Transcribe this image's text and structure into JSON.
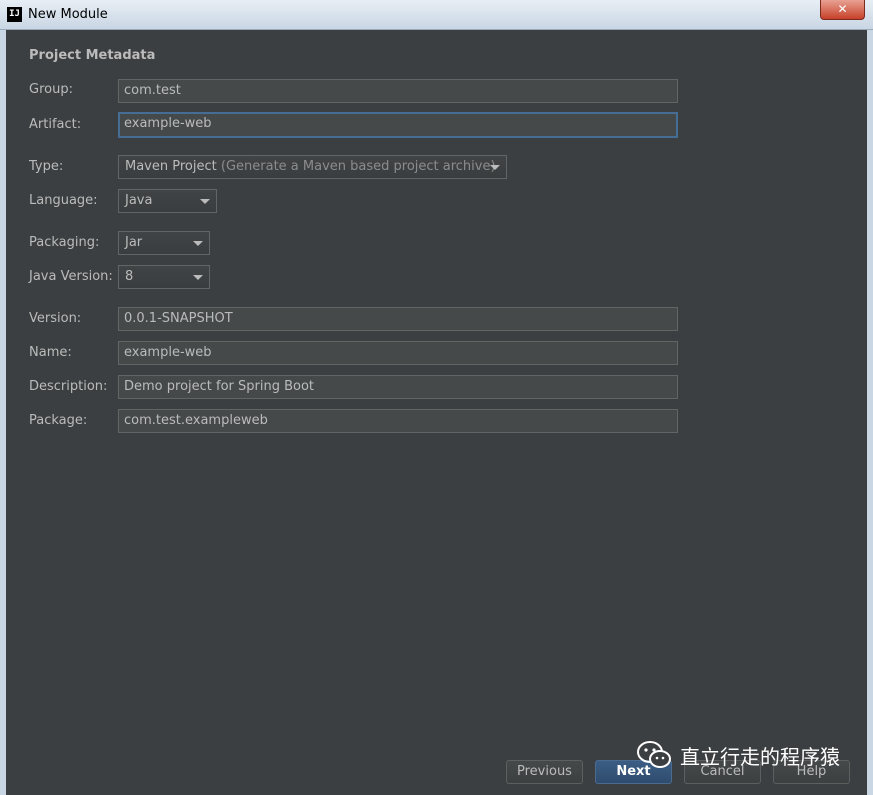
{
  "window": {
    "app_icon_text": "IJ",
    "title": "New Module",
    "close_glyph": "✕"
  },
  "section_title": "Project Metadata",
  "fields": {
    "group": {
      "label": "Group:",
      "value": "com.test"
    },
    "artifact": {
      "label": "Artifact:",
      "value": "example-web"
    },
    "type": {
      "label": "Type:",
      "value": "Maven Project",
      "hint": "(Generate a Maven based project archive)"
    },
    "language": {
      "label": "Language:",
      "value": "Java"
    },
    "packaging": {
      "label": "Packaging:",
      "value": "Jar"
    },
    "java_version": {
      "label": "Java Version:",
      "value": "8"
    },
    "version": {
      "label": "Version:",
      "value": "0.0.1-SNAPSHOT"
    },
    "name": {
      "label": "Name:",
      "value": "example-web"
    },
    "description": {
      "label": "Description:",
      "value": "Demo project for Spring Boot"
    },
    "package": {
      "label": "Package:",
      "value": "com.test.exampleweb"
    }
  },
  "buttons": {
    "previous": "Previous",
    "next": "Next",
    "cancel": "Cancel",
    "help": "Help"
  },
  "watermark": {
    "icon": "wechat-icon",
    "text": "直立行走的程序猿"
  },
  "colors": {
    "background": "#3c3f41",
    "focus_border": "#466d94",
    "primary_button": "#365880"
  }
}
